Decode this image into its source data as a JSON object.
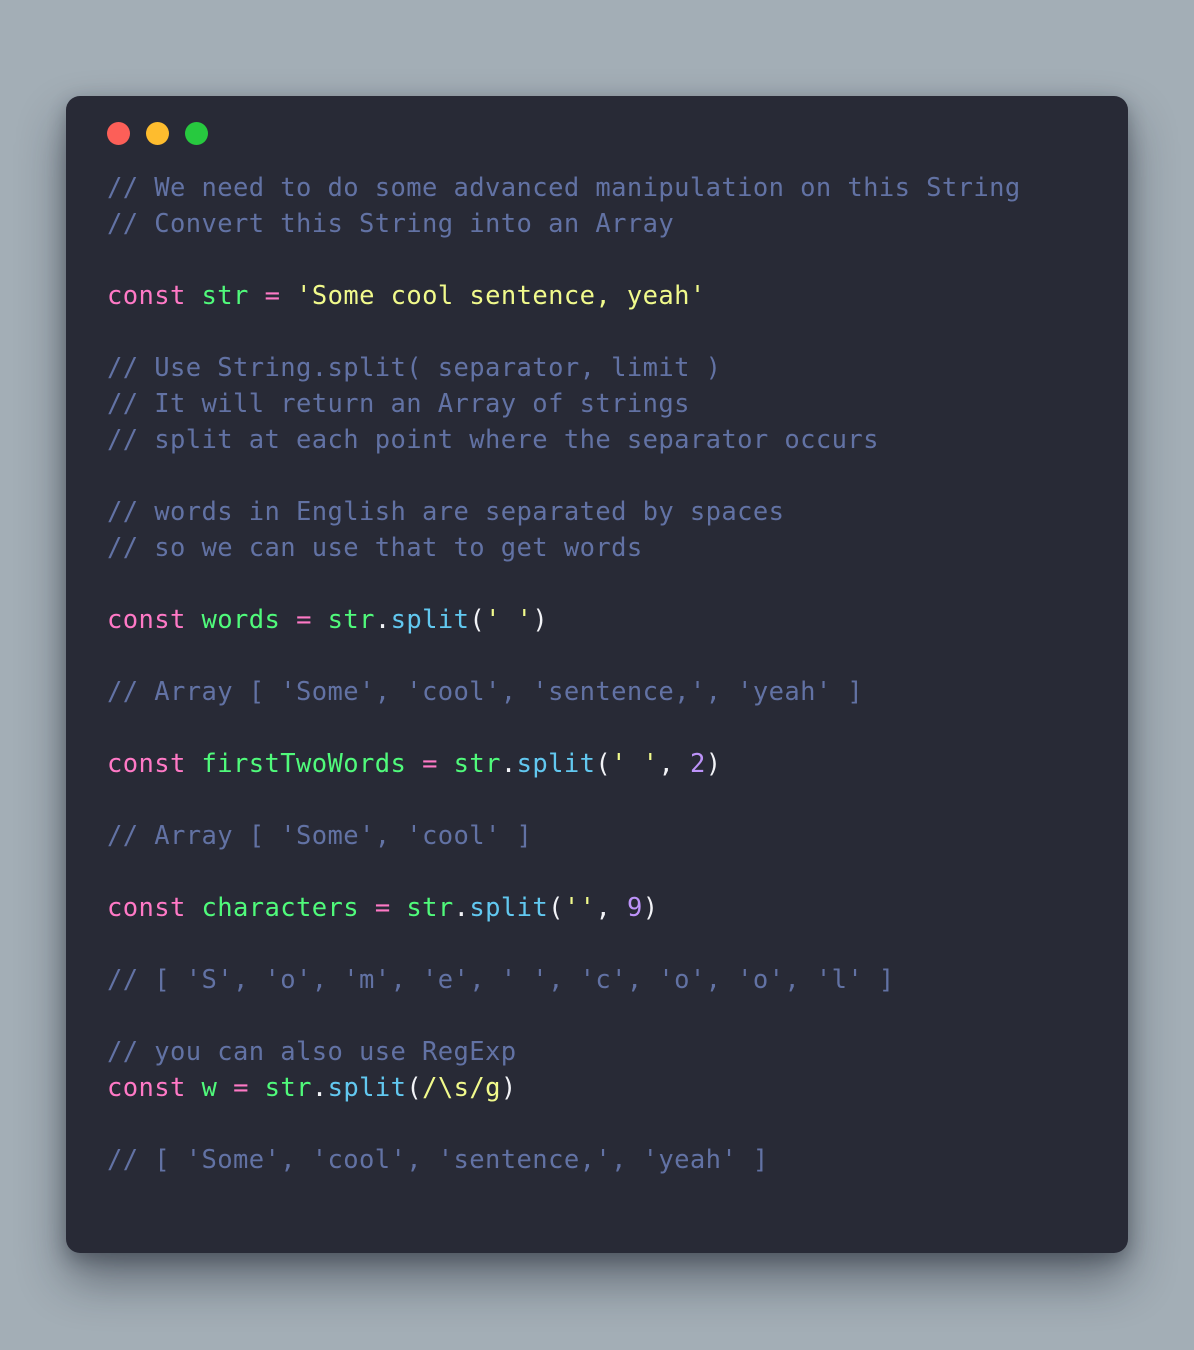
{
  "window": {
    "controls": [
      {
        "name": "close",
        "color": "#fc5f58"
      },
      {
        "name": "minimize",
        "color": "#febc2e"
      },
      {
        "name": "zoom",
        "color": "#27c93f"
      }
    ],
    "background": "#282a36",
    "page_background": "#a3aeb6"
  },
  "theme": {
    "comment": "#6272a4",
    "keyword": "#ff79c6",
    "variable": "#50fa7b",
    "operator": "#ff79c6",
    "string": "#f1fa8c",
    "method": "#62c8f0",
    "punctuation": "#f2f3f7",
    "number": "#bd93f9"
  },
  "code": {
    "language": "javascript",
    "lines": [
      {
        "id": 1,
        "type": "comment",
        "text": "// We need to do some advanced manipulation on this String"
      },
      {
        "id": 2,
        "type": "comment",
        "text": "// Convert this String into an Array"
      },
      {
        "id": 3,
        "type": "blank",
        "text": ""
      },
      {
        "id": 4,
        "type": "code",
        "text": "const str = 'Some cool sentence, yeah'",
        "tokens": [
          {
            "t": "keyword",
            "v": "const"
          },
          {
            "t": "punct",
            "v": " "
          },
          {
            "t": "var",
            "v": "str"
          },
          {
            "t": "punct",
            "v": " "
          },
          {
            "t": "op",
            "v": "="
          },
          {
            "t": "punct",
            "v": " "
          },
          {
            "t": "string",
            "v": "'Some cool sentence, yeah'"
          }
        ]
      },
      {
        "id": 5,
        "type": "blank",
        "text": ""
      },
      {
        "id": 6,
        "type": "comment",
        "text": "// Use String.split( separator, limit )"
      },
      {
        "id": 7,
        "type": "comment",
        "text": "// It will return an Array of strings"
      },
      {
        "id": 8,
        "type": "comment",
        "text": "// split at each point where the separator occurs"
      },
      {
        "id": 9,
        "type": "blank",
        "text": ""
      },
      {
        "id": 10,
        "type": "comment",
        "text": "// words in English are separated by spaces"
      },
      {
        "id": 11,
        "type": "comment",
        "text": "// so we can use that to get words"
      },
      {
        "id": 12,
        "type": "blank",
        "text": ""
      },
      {
        "id": 13,
        "type": "code",
        "text": "const words = str.split(' ')",
        "tokens": [
          {
            "t": "keyword",
            "v": "const"
          },
          {
            "t": "punct",
            "v": " "
          },
          {
            "t": "var",
            "v": "words"
          },
          {
            "t": "punct",
            "v": " "
          },
          {
            "t": "op",
            "v": "="
          },
          {
            "t": "punct",
            "v": " "
          },
          {
            "t": "var",
            "v": "str"
          },
          {
            "t": "punct",
            "v": "."
          },
          {
            "t": "method",
            "v": "split"
          },
          {
            "t": "punct",
            "v": "("
          },
          {
            "t": "string",
            "v": "' '"
          },
          {
            "t": "punct",
            "v": ")"
          }
        ]
      },
      {
        "id": 14,
        "type": "blank",
        "text": ""
      },
      {
        "id": 15,
        "type": "comment",
        "text": "// Array [ 'Some', 'cool', 'sentence,', 'yeah' ]"
      },
      {
        "id": 16,
        "type": "blank",
        "text": ""
      },
      {
        "id": 17,
        "type": "code",
        "text": "const firstTwoWords = str.split(' ', 2)",
        "tokens": [
          {
            "t": "keyword",
            "v": "const"
          },
          {
            "t": "punct",
            "v": " "
          },
          {
            "t": "var",
            "v": "firstTwoWords"
          },
          {
            "t": "punct",
            "v": " "
          },
          {
            "t": "op",
            "v": "="
          },
          {
            "t": "punct",
            "v": " "
          },
          {
            "t": "var",
            "v": "str"
          },
          {
            "t": "punct",
            "v": "."
          },
          {
            "t": "method",
            "v": "split"
          },
          {
            "t": "punct",
            "v": "("
          },
          {
            "t": "string",
            "v": "' '"
          },
          {
            "t": "punct",
            "v": ", "
          },
          {
            "t": "number",
            "v": "2"
          },
          {
            "t": "punct",
            "v": ")"
          }
        ]
      },
      {
        "id": 18,
        "type": "blank",
        "text": ""
      },
      {
        "id": 19,
        "type": "comment",
        "text": "// Array [ 'Some', 'cool' ]"
      },
      {
        "id": 20,
        "type": "blank",
        "text": ""
      },
      {
        "id": 21,
        "type": "code",
        "text": "const characters = str.split('', 9)",
        "tokens": [
          {
            "t": "keyword",
            "v": "const"
          },
          {
            "t": "punct",
            "v": " "
          },
          {
            "t": "var",
            "v": "characters"
          },
          {
            "t": "punct",
            "v": " "
          },
          {
            "t": "op",
            "v": "="
          },
          {
            "t": "punct",
            "v": " "
          },
          {
            "t": "var",
            "v": "str"
          },
          {
            "t": "punct",
            "v": "."
          },
          {
            "t": "method",
            "v": "split"
          },
          {
            "t": "punct",
            "v": "("
          },
          {
            "t": "string",
            "v": "''"
          },
          {
            "t": "punct",
            "v": ", "
          },
          {
            "t": "number",
            "v": "9"
          },
          {
            "t": "punct",
            "v": ")"
          }
        ]
      },
      {
        "id": 22,
        "type": "blank",
        "text": ""
      },
      {
        "id": 23,
        "type": "comment",
        "text": "// [ 'S', 'o', 'm', 'e', ' ', 'c', 'o', 'o', 'l' ]"
      },
      {
        "id": 24,
        "type": "blank",
        "text": ""
      },
      {
        "id": 25,
        "type": "comment",
        "text": "// you can also use RegExp"
      },
      {
        "id": 26,
        "type": "code",
        "text": "const w = str.split(/\\s/g)",
        "tokens": [
          {
            "t": "keyword",
            "v": "const"
          },
          {
            "t": "punct",
            "v": " "
          },
          {
            "t": "var",
            "v": "w"
          },
          {
            "t": "punct",
            "v": " "
          },
          {
            "t": "op",
            "v": "="
          },
          {
            "t": "punct",
            "v": " "
          },
          {
            "t": "var",
            "v": "str"
          },
          {
            "t": "punct",
            "v": "."
          },
          {
            "t": "method",
            "v": "split"
          },
          {
            "t": "punct",
            "v": "("
          },
          {
            "t": "regex",
            "v": "/\\s/g"
          },
          {
            "t": "punct",
            "v": ")"
          }
        ]
      },
      {
        "id": 27,
        "type": "blank",
        "text": ""
      },
      {
        "id": 28,
        "type": "comment",
        "text": "// [ 'Some', 'cool', 'sentence,', 'yeah' ]"
      }
    ]
  }
}
